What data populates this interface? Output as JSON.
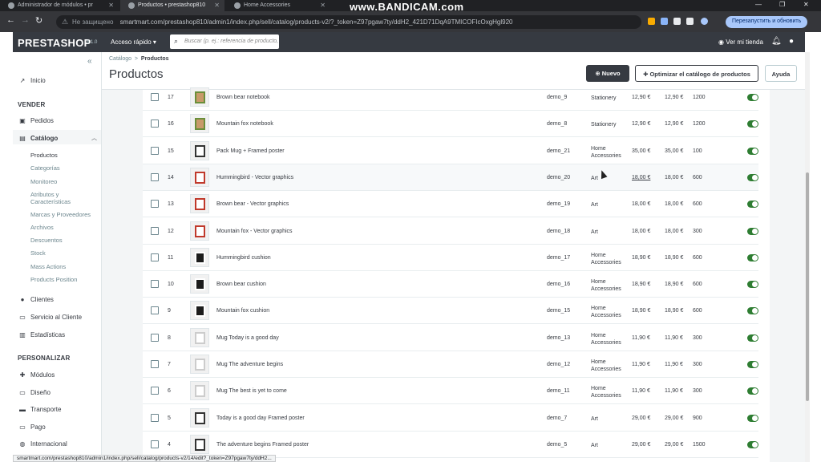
{
  "browser": {
    "tabs": [
      {
        "title": "Administrador de módulos • pr"
      },
      {
        "title": "Productos • prestashop810"
      },
      {
        "title": "Home Accessories"
      }
    ],
    "watermark": "www.BANDICAM.com",
    "security_label": "Не защищено",
    "url": "smartmart.com/prestashop810/admin1/index.php/sell/catalog/products-v2/?_token=Z97pgaw7ty/ddH2_421D71DqA9TMICOFIcOxgHgl920",
    "relaunch_label": "Перезапустить и обновить",
    "status_url": "smartmart.com/prestashop810/admin1/index.php/sell/catalog/products-v2/14/edit?_token=Z97pgaw7ty/ddH2..."
  },
  "header": {
    "logo": "PRESTASHOP",
    "version": "8.1.0",
    "quick_access": "Acceso rápido ▾",
    "search_placeholder": "Buscar (p. ej.: referencia de producto,",
    "view_store": "Ver mi tienda"
  },
  "sidebar": {
    "inicio": "Inicio",
    "section_vender": "VENDER",
    "pedidos": "Pedidos",
    "catalogo": "Catálogo",
    "catalog_sub": [
      "Productos",
      "Categorías",
      "Monitoreo",
      "Atributos y Características",
      "Marcas y Proveedores",
      "Archivos",
      "Descuentos",
      "Stock",
      "Mass Actions",
      "Products Position"
    ],
    "clientes": "Clientes",
    "servicio": "Servicio al Cliente",
    "estadisticas": "Estadísticas",
    "section_personalizar": "PERSONALIZAR",
    "modulos": "Módulos",
    "diseno": "Diseño",
    "transporte": "Transporte",
    "pago": "Pago",
    "internacional": "Internacional"
  },
  "page": {
    "breadcrumb_parent": "Catálogo",
    "breadcrumb_sep": ">",
    "breadcrumb_current": "Productos",
    "title": "Productos",
    "btn_new": "Nuevo",
    "btn_optimize": "Optimizar el catálogo de productos",
    "btn_help": "Ayuda"
  },
  "products": [
    {
      "id": "17",
      "name": "Brown bear notebook",
      "ref": "demo_9",
      "category": "Stationery",
      "price_ex": "12,90 €",
      "price_inc": "12,90 €",
      "qty": "1200",
      "thumb": "notebook"
    },
    {
      "id": "16",
      "name": "Mountain fox notebook",
      "ref": "demo_8",
      "category": "Stationery",
      "price_ex": "12,90 €",
      "price_inc": "12,90 €",
      "qty": "1200",
      "thumb": "notebook"
    },
    {
      "id": "15",
      "name": "Pack Mug + Framed poster",
      "ref": "demo_21",
      "category": "Home Accessories",
      "price_ex": "35,00 €",
      "price_inc": "35,00 €",
      "qty": "100",
      "thumb": "frame"
    },
    {
      "id": "14",
      "name": "Hummingbird - Vector graphics",
      "ref": "demo_20",
      "category": "Art",
      "price_ex": "18,00 €",
      "price_inc": "18,00 €",
      "qty": "600",
      "thumb": "vector"
    },
    {
      "id": "13",
      "name": "Brown bear - Vector graphics",
      "ref": "demo_19",
      "category": "Art",
      "price_ex": "18,00 €",
      "price_inc": "18,00 €",
      "qty": "600",
      "thumb": "vector"
    },
    {
      "id": "12",
      "name": "Mountain fox - Vector graphics",
      "ref": "demo_18",
      "category": "Art",
      "price_ex": "18,00 €",
      "price_inc": "18,00 €",
      "qty": "300",
      "thumb": "vector"
    },
    {
      "id": "11",
      "name": "Hummingbird cushion",
      "ref": "demo_17",
      "category": "Home Accessories",
      "price_ex": "18,90 €",
      "price_inc": "18,90 €",
      "qty": "600",
      "thumb": "cushion"
    },
    {
      "id": "10",
      "name": "Brown bear cushion",
      "ref": "demo_16",
      "category": "Home Accessories",
      "price_ex": "18,90 €",
      "price_inc": "18,90 €",
      "qty": "600",
      "thumb": "cushion"
    },
    {
      "id": "9",
      "name": "Mountain fox cushion",
      "ref": "demo_15",
      "category": "Home Accessories",
      "price_ex": "18,90 €",
      "price_inc": "18,90 €",
      "qty": "600",
      "thumb": "cushion"
    },
    {
      "id": "8",
      "name": "Mug Today is a good day",
      "ref": "demo_13",
      "category": "Home Accessories",
      "price_ex": "11,90 €",
      "price_inc": "11,90 €",
      "qty": "300",
      "thumb": "mug"
    },
    {
      "id": "7",
      "name": "Mug The adventure begins",
      "ref": "demo_12",
      "category": "Home Accessories",
      "price_ex": "11,90 €",
      "price_inc": "11,90 €",
      "qty": "300",
      "thumb": "mug"
    },
    {
      "id": "6",
      "name": "Mug The best is yet to come",
      "ref": "demo_11",
      "category": "Home Accessories",
      "price_ex": "11,90 €",
      "price_inc": "11,90 €",
      "qty": "300",
      "thumb": "mug"
    },
    {
      "id": "5",
      "name": "Today is a good day Framed poster",
      "ref": "demo_7",
      "category": "Art",
      "price_ex": "29,00 €",
      "price_inc": "29,00 €",
      "qty": "900",
      "thumb": "frame"
    },
    {
      "id": "4",
      "name": "The adventure begins Framed poster",
      "ref": "demo_5",
      "category": "Art",
      "price_ex": "29,00 €",
      "price_inc": "29,00 €",
      "qty": "1500",
      "thumb": "frame"
    }
  ],
  "colors": {
    "toggle_on": "#2e7d32",
    "header_bg": "#363a41",
    "accent": "#25b9d7"
  }
}
